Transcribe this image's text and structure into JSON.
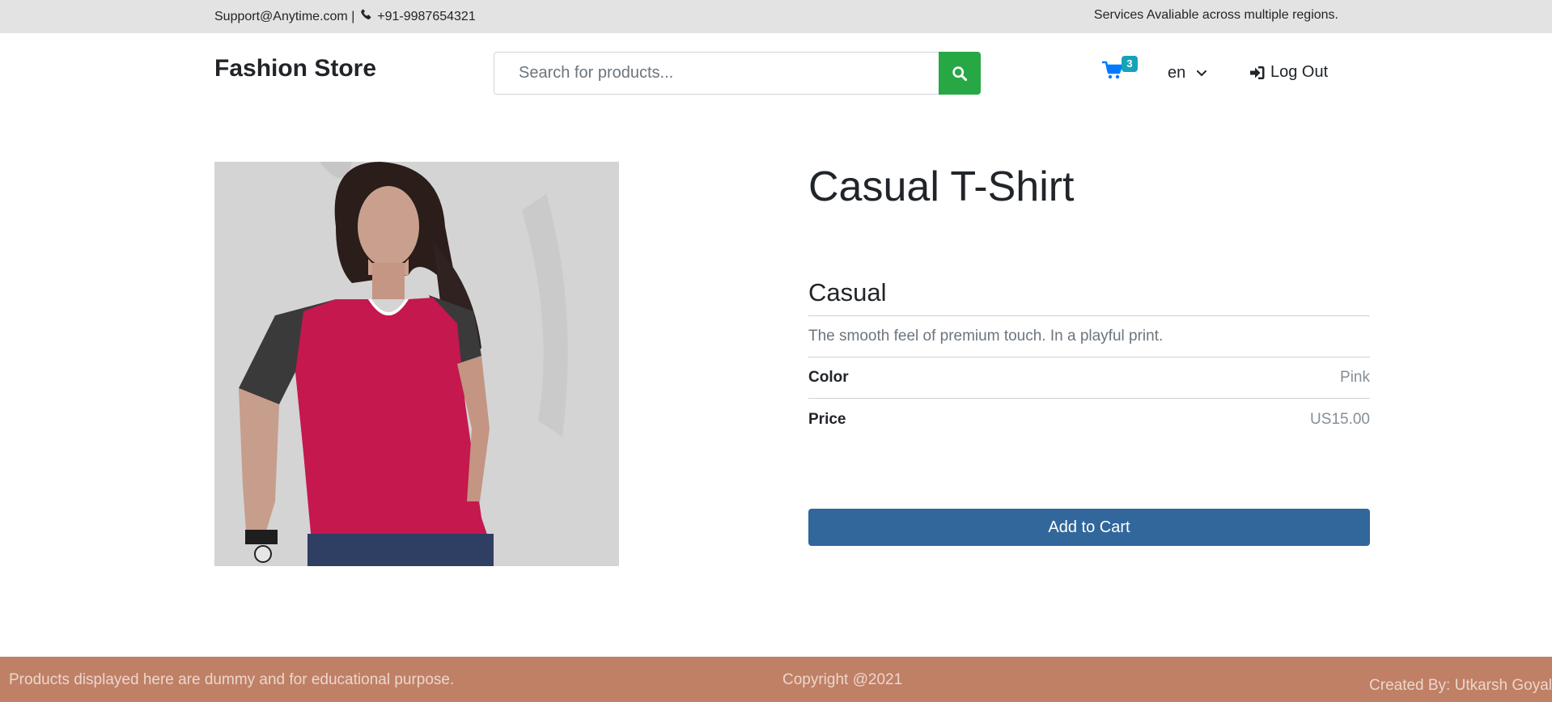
{
  "topbar": {
    "email": "Support@Anytime.com |",
    "phone": "+91-9987654321",
    "regions": "Services Avaliable across multiple regions."
  },
  "header": {
    "brand": "Fashion Store",
    "search_placeholder": "Search for products...",
    "cart_count": "3",
    "language": "en",
    "logout_label": "Log Out"
  },
  "product": {
    "image_alt": "Woman wearing pink and dark grey Casual T-Shirt",
    "title": "Casual T-Shirt",
    "category": "Casual",
    "description": "The smooth feel of premium touch. In a playful print.",
    "color_label": "Color",
    "color_value": "Pink",
    "price_label": "Price",
    "price_value": "US15.00",
    "add_to_cart": "Add to Cart"
  },
  "footer": {
    "disclaimer": "Products displayed here are dummy and for educational purpose.",
    "copyright": "Copyright @2021",
    "credit": "Created By: Utkarsh Goyal"
  },
  "colors": {
    "search_button": "#28a745",
    "cart_icon": "#007bff",
    "cart_badge": "#17a2b8",
    "add_to_cart": "#31679b",
    "footer": "#bf8066",
    "topbar": "#e3e3e3"
  },
  "icons": {
    "phone": "phone-icon",
    "search": "search-icon",
    "cart": "cart-icon",
    "language_dropdown": "chevron-down-icon",
    "logout": "sign-in-icon"
  }
}
